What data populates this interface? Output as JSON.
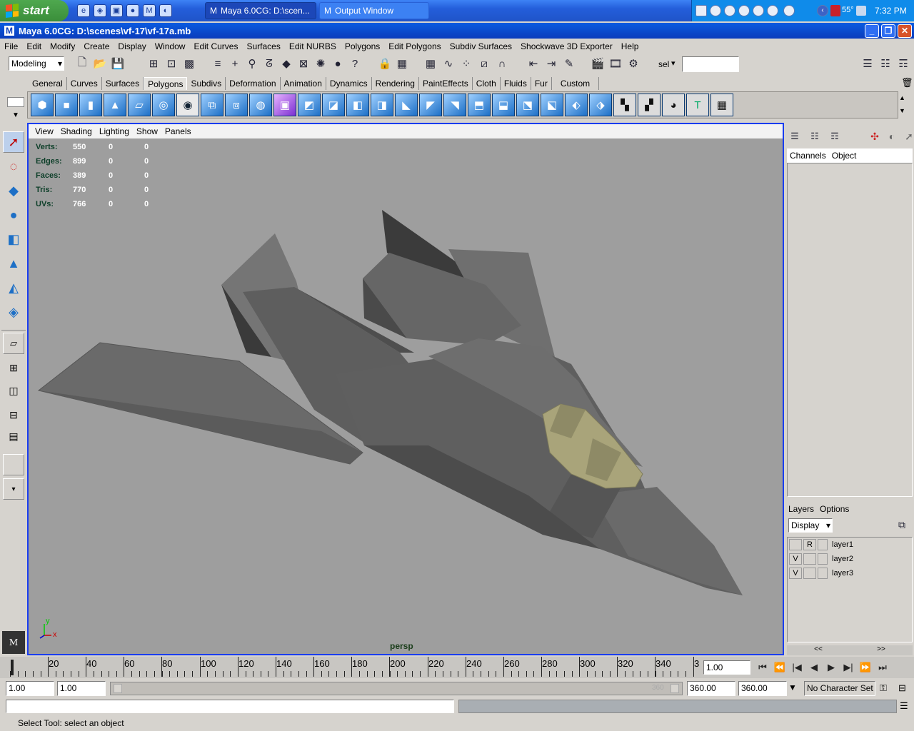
{
  "taskbar": {
    "start_label": "start",
    "windows": [
      {
        "label": "Maya 6.0CG: D:\\scen..."
      },
      {
        "label": "Output Window"
      }
    ],
    "tray": {
      "temperature": "55°",
      "clock": "7:32 PM"
    }
  },
  "window": {
    "title": "Maya 6.0CG: D:\\scenes\\vf-17\\vf-17a.mb"
  },
  "menubar": {
    "items": [
      "File",
      "Edit",
      "Modify",
      "Create",
      "Display",
      "Window",
      "Edit Curves",
      "Surfaces",
      "Edit NURBS",
      "Polygons",
      "Edit Polygons",
      "Subdiv Surfaces",
      "Shockwave 3D Exporter",
      "Help"
    ]
  },
  "statusline": {
    "menuset": "Modeling",
    "sel_label": "sel",
    "sel_value": ""
  },
  "shelf": {
    "tabs": [
      "General",
      "Curves",
      "Surfaces",
      "Polygons",
      "Subdivs",
      "Deformation",
      "Animation",
      "Dynamics",
      "Rendering",
      "PaintEffects",
      "Cloth",
      "Fluids",
      "Fur",
      "Custom"
    ],
    "active_tab": "Polygons"
  },
  "viewport": {
    "menu": [
      "View",
      "Shading",
      "Lighting",
      "Show",
      "Panels"
    ],
    "camera": "persp",
    "hud": [
      {
        "label": "Verts:",
        "v1": "550",
        "v2": "0",
        "v3": "0"
      },
      {
        "label": "Edges:",
        "v1": "899",
        "v2": "0",
        "v3": "0"
      },
      {
        "label": "Faces:",
        "v1": "389",
        "v2": "0",
        "v3": "0"
      },
      {
        "label": "Tris:",
        "v1": "770",
        "v2": "0",
        "v3": "0"
      },
      {
        "label": "UVs:",
        "v1": "766",
        "v2": "0",
        "v3": "0"
      }
    ],
    "axis_y": "y",
    "axis_x": "x",
    "colors": {
      "background": "#9e9e9e",
      "model": "#5a5a5a",
      "canopy": "#a9a47a",
      "border": "#1a3df0"
    }
  },
  "channelbox": {
    "tabs": [
      "Channels",
      "Object"
    ]
  },
  "layers": {
    "tabs": [
      "Layers",
      "Options"
    ],
    "display_mode": "Display",
    "rows": [
      {
        "vis": "",
        "type": "R",
        "name": "layer1"
      },
      {
        "vis": "V",
        "type": "",
        "name": "layer2"
      },
      {
        "vis": "V",
        "type": "",
        "name": "layer3"
      }
    ],
    "scroll_left": "<<",
    "scroll_right": ">>"
  },
  "timeline": {
    "ticks": [
      "20",
      "40",
      "60",
      "80",
      "100",
      "120",
      "140",
      "160",
      "180",
      "200",
      "220",
      "240",
      "260",
      "280",
      "300",
      "320",
      "340",
      "3"
    ],
    "current_frame": "1.00"
  },
  "range": {
    "start": "1.00",
    "playback_start": "1.00",
    "slider_end_ghost": "360",
    "playback_end": "360.00",
    "end": "360.00",
    "character_set": "No Character Set"
  },
  "helpline": {
    "text": "Select Tool: select an object"
  }
}
